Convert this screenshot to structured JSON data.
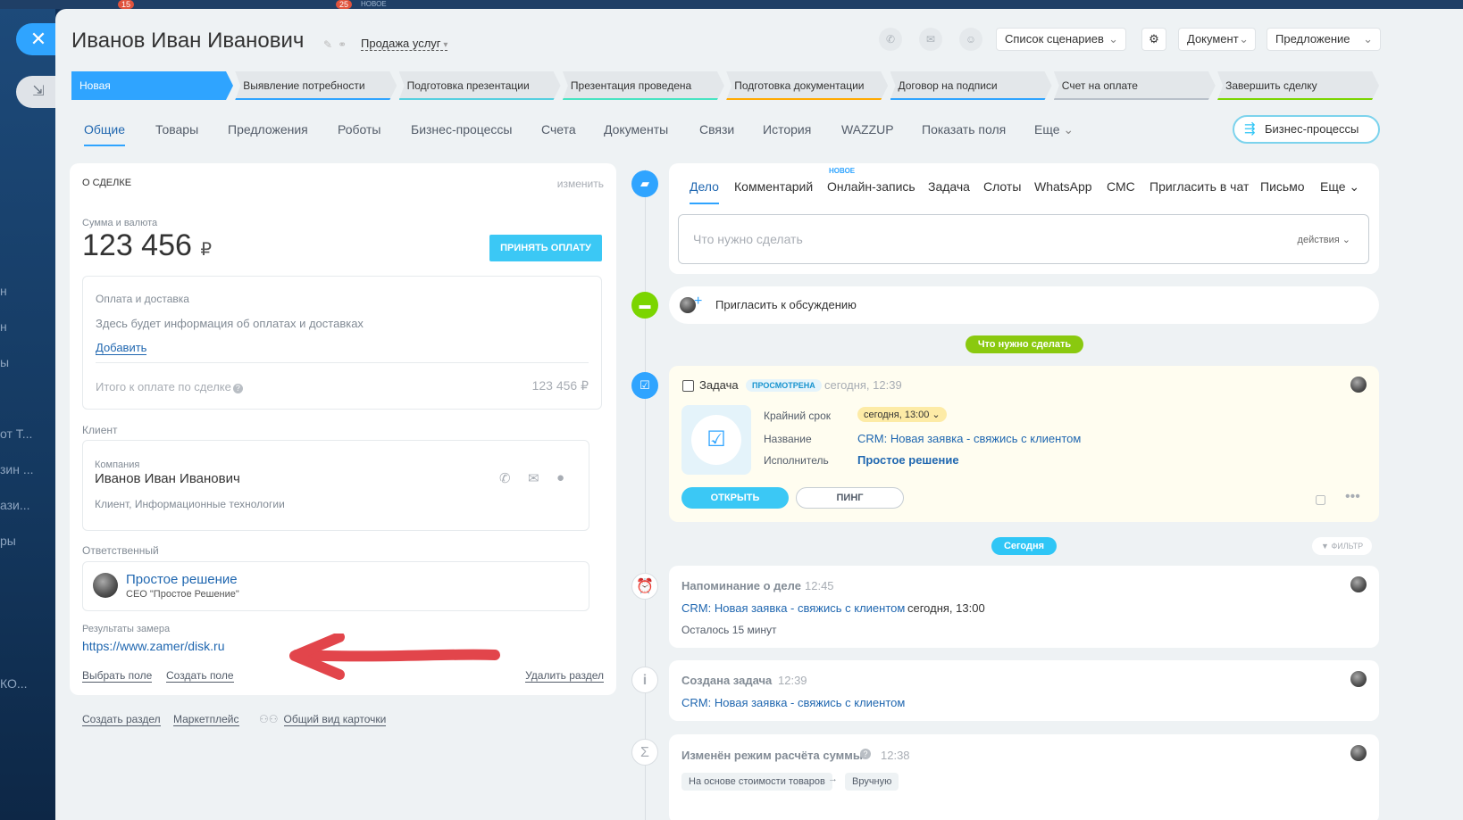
{
  "top_badges": [
    {
      "count": "15"
    },
    {
      "count": "25"
    }
  ],
  "top_new": "НОВОЕ",
  "close_icon": "close-icon",
  "bg_sidebar": [
    "н",
    "н",
    "ы",
    "от Т...",
    "зин ...",
    "ази...",
    "ры",
    "КО..."
  ],
  "header": {
    "title": "Иванов Иван Иванович",
    "category": "Продажа услуг",
    "scenarios": "Список сценариев",
    "document": "Документ",
    "offer": "Предложение"
  },
  "stages": [
    {
      "label": "Новая",
      "color": "#2fa4ff",
      "active": true
    },
    {
      "label": "Выявление потребности",
      "color": "#2fa4ff"
    },
    {
      "label": "Подготовка презентации",
      "color": "#55d0e0"
    },
    {
      "label": "Презентация проведена",
      "color": "#47e4c2"
    },
    {
      "label": "Подготовка документации",
      "color": "#ffa900"
    },
    {
      "label": "Договор на подписи",
      "color": "#2fa4ff"
    },
    {
      "label": "Счет на оплате",
      "color": "#b8c0c9"
    },
    {
      "label": "Завершить сделку",
      "color": "#7bd500"
    }
  ],
  "tabs": [
    "Общие",
    "Товары",
    "Предложения",
    "Роботы",
    "Бизнес-процессы",
    "Счета",
    "Документы",
    "Связи",
    "История",
    "WAZZUP",
    "Показать поля",
    "Еще"
  ],
  "bp_button": "Бизнес-процессы",
  "deal": {
    "section": "О СДЕЛКЕ",
    "edit": "изменить",
    "amount_label": "Сумма и валюта",
    "amount": "123 456",
    "currency": "₽",
    "pay_btn": "ПРИНЯТЬ ОПЛАТУ",
    "pay_delivery": "Оплата и доставка",
    "pay_info": "Здесь будет информация об оплатах и доставках",
    "add": "Добавить",
    "total_label": "Итого к оплате по сделке",
    "total": "123 456 ₽",
    "client_label": "Клиент",
    "company_label": "Компания",
    "company": "Иванов Иван Иванович",
    "company_desc": "Клиент, Информационные технологии",
    "responsible_label": "Ответственный",
    "responsible": "Простое решение",
    "responsible_pos": "СЕО \"Простое Решение\"",
    "measure_label": "Результаты замера",
    "measure_link": "https://www.zamer/disk.ru",
    "choose_field": "Выбрать поле",
    "create_field": "Создать поле",
    "delete_section": "Удалить раздел"
  },
  "bottom_links": {
    "create_section": "Создать раздел",
    "market": "Маркетплейс",
    "card_view": "Общий вид карточки"
  },
  "activity": {
    "new_label": "НОВОЕ",
    "tabs": [
      "Дело",
      "Комментарий",
      "Онлайн-запись",
      "Задача",
      "Слоты",
      "WhatsApp",
      "СМС",
      "Пригласить в чат",
      "Письмо",
      "Еще"
    ],
    "placeholder": "Что нужно сделать",
    "actions": "действия",
    "invite": "Пригласить к обсуждению"
  },
  "todo_pill": "Что нужно сделать",
  "task": {
    "title": "Задача",
    "status": "ПРОСМОТРЕНА",
    "time": "сегодня, 12:39",
    "deadline_label": "Крайний срок",
    "deadline": "сегодня, 13:00",
    "name_label": "Название",
    "name": "CRM: Новая заявка - свяжись с клиентом",
    "exec_label": "Исполнитель",
    "exec": "Простое решение",
    "open": "ОТКРЫТЬ",
    "ping": "ПИНГ"
  },
  "today_pill": "Сегодня",
  "filter": "ФИЛЬТР",
  "reminder": {
    "title": "Напоминание о деле",
    "time": "12:45",
    "link": "CRM: Новая заявка - свяжись с клиентом",
    "when": "сегодня, 13:00",
    "left": "Осталось 15 минут"
  },
  "created": {
    "title": "Создана задача",
    "time": "12:39",
    "link": "CRM: Новая заявка - свяжись с клиентом"
  },
  "changed": {
    "title": "Изменён режим расчёта суммы",
    "time": "12:38",
    "from": "На основе стоимости товаров",
    "to": "Вручную"
  }
}
